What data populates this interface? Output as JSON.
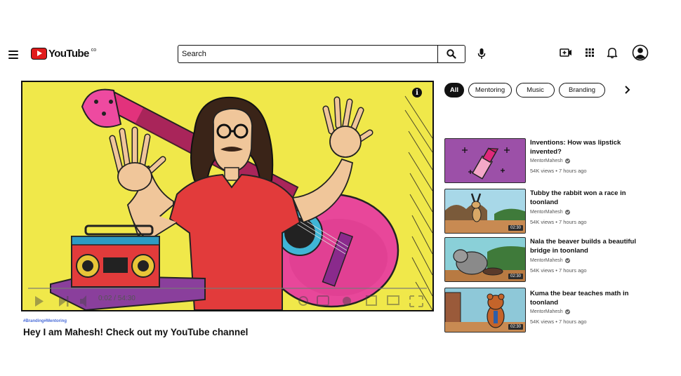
{
  "header": {
    "logo_text": "YouTube",
    "logo_suffix": "co",
    "search_placeholder": "Search"
  },
  "video": {
    "time": "0:02 / 54:30",
    "tags": "#Branding#Mentoring",
    "title": "Hey I am Mahesh! Check out my YouTube channel",
    "progress_fraction": 0.0006
  },
  "chips": [
    {
      "label": "All",
      "active": true
    },
    {
      "label": "Mentoring",
      "active": false
    },
    {
      "label": "Music",
      "active": false
    },
    {
      "label": "Branding",
      "active": false
    }
  ],
  "recommended": [
    {
      "title": "Inventions: How was lipstick invented?",
      "channel": "MentorMahesh",
      "meta": "54K views • 7 hours ago",
      "duration": ""
    },
    {
      "title": "Tubby the rabbit won a race in toonland",
      "channel": "MentorMahesh",
      "meta": "54K views • 7 hours ago",
      "duration": "02:30"
    },
    {
      "title": "Nala the beaver builds a beautiful bridge in toonland",
      "channel": "MentorMahesh",
      "meta": "54K views • 7 hours ago",
      "duration": "02:30"
    },
    {
      "title": "Kuma the bear teaches math in toonland",
      "channel": "MentorMahesh",
      "meta": "54K views • 7 hours ago",
      "duration": "02:30"
    }
  ],
  "colors": {
    "brand_red": "#e01b1b",
    "video_bg": "#f0e84a",
    "tag_blue": "#4a6cd8"
  }
}
